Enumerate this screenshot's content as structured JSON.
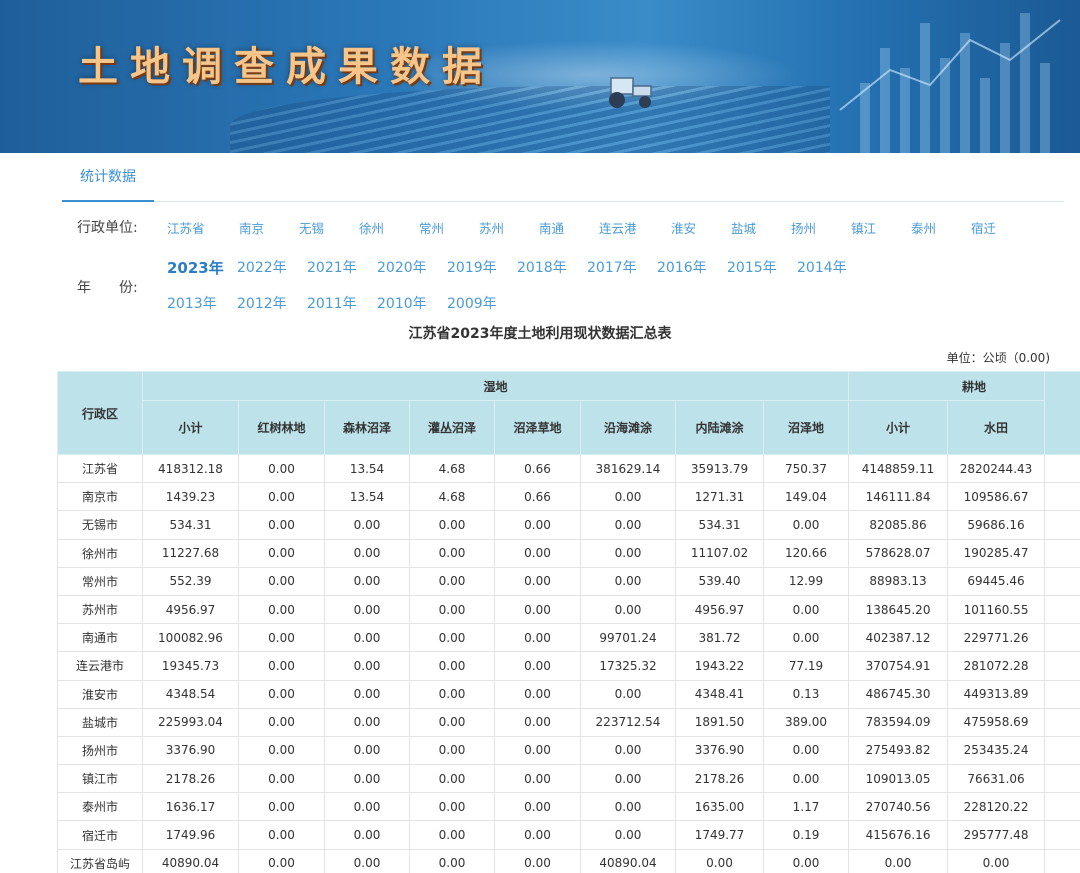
{
  "banner": {
    "title": "土地调查成果数据"
  },
  "tabs": [
    {
      "label": "统计数据"
    }
  ],
  "filters": {
    "region_label": "行政单位:",
    "year_label": "年　　份:",
    "regions": [
      "江苏省",
      "南京",
      "无锡",
      "徐州",
      "常州",
      "苏州",
      "南通",
      "连云港",
      "淮安",
      "盐城",
      "扬州",
      "镇江",
      "泰州",
      "宿迁"
    ],
    "years_row1": [
      "2023年",
      "2022年",
      "2021年",
      "2020年",
      "2019年",
      "2018年",
      "2017年",
      "2016年",
      "2015年",
      "2014年"
    ],
    "years_row2": [
      "2013年",
      "2012年",
      "2011年",
      "2010年",
      "2009年"
    ],
    "active_year": "2023年"
  },
  "table": {
    "title": "江苏省2023年度土地利用现状数据汇总表",
    "unit": "单位：公顷（0.00)",
    "region_header": "行政区",
    "groups": [
      {
        "label": "湿地",
        "span": 8
      },
      {
        "label": "耕地",
        "span": 2
      }
    ],
    "columns": [
      "小计",
      "红树林地",
      "森林沼泽",
      "灌丛沼泽",
      "沼泽草地",
      "沿海滩涂",
      "内陆滩涂",
      "沼泽地",
      "小计",
      "水田"
    ],
    "rows": [
      [
        "江苏省",
        "418312.18",
        "0.00",
        "13.54",
        "4.68",
        "0.66",
        "381629.14",
        "35913.79",
        "750.37",
        "4148859.11",
        "2820244.43"
      ],
      [
        "南京市",
        "1439.23",
        "0.00",
        "13.54",
        "4.68",
        "0.66",
        "0.00",
        "1271.31",
        "149.04",
        "146111.84",
        "109586.67"
      ],
      [
        "无锡市",
        "534.31",
        "0.00",
        "0.00",
        "0.00",
        "0.00",
        "0.00",
        "534.31",
        "0.00",
        "82085.86",
        "59686.16"
      ],
      [
        "徐州市",
        "11227.68",
        "0.00",
        "0.00",
        "0.00",
        "0.00",
        "0.00",
        "11107.02",
        "120.66",
        "578628.07",
        "190285.47"
      ],
      [
        "常州市",
        "552.39",
        "0.00",
        "0.00",
        "0.00",
        "0.00",
        "0.00",
        "539.40",
        "12.99",
        "88983.13",
        "69445.46"
      ],
      [
        "苏州市",
        "4956.97",
        "0.00",
        "0.00",
        "0.00",
        "0.00",
        "0.00",
        "4956.97",
        "0.00",
        "138645.20",
        "101160.55"
      ],
      [
        "南通市",
        "100082.96",
        "0.00",
        "0.00",
        "0.00",
        "0.00",
        "99701.24",
        "381.72",
        "0.00",
        "402387.12",
        "229771.26"
      ],
      [
        "连云港市",
        "19345.73",
        "0.00",
        "0.00",
        "0.00",
        "0.00",
        "17325.32",
        "1943.22",
        "77.19",
        "370754.91",
        "281072.28"
      ],
      [
        "淮安市",
        "4348.54",
        "0.00",
        "0.00",
        "0.00",
        "0.00",
        "0.00",
        "4348.41",
        "0.13",
        "486745.30",
        "449313.89"
      ],
      [
        "盐城市",
        "225993.04",
        "0.00",
        "0.00",
        "0.00",
        "0.00",
        "223712.54",
        "1891.50",
        "389.00",
        "783594.09",
        "475958.69"
      ],
      [
        "扬州市",
        "3376.90",
        "0.00",
        "0.00",
        "0.00",
        "0.00",
        "0.00",
        "3376.90",
        "0.00",
        "275493.82",
        "253435.24"
      ],
      [
        "镇江市",
        "2178.26",
        "0.00",
        "0.00",
        "0.00",
        "0.00",
        "0.00",
        "2178.26",
        "0.00",
        "109013.05",
        "76631.06"
      ],
      [
        "泰州市",
        "1636.17",
        "0.00",
        "0.00",
        "0.00",
        "0.00",
        "0.00",
        "1635.00",
        "1.17",
        "270740.56",
        "228120.22"
      ],
      [
        "宿迁市",
        "1749.96",
        "0.00",
        "0.00",
        "0.00",
        "0.00",
        "0.00",
        "1749.77",
        "0.19",
        "415676.16",
        "295777.48"
      ],
      [
        "江苏省岛屿",
        "40890.04",
        "0.00",
        "0.00",
        "0.00",
        "0.00",
        "40890.04",
        "0.00",
        "0.00",
        "0.00",
        "0.00"
      ]
    ]
  },
  "colors": {
    "accent": "#3a8fd0",
    "header_bg": "#bde2ea",
    "title_orange": "#f6c58a"
  }
}
